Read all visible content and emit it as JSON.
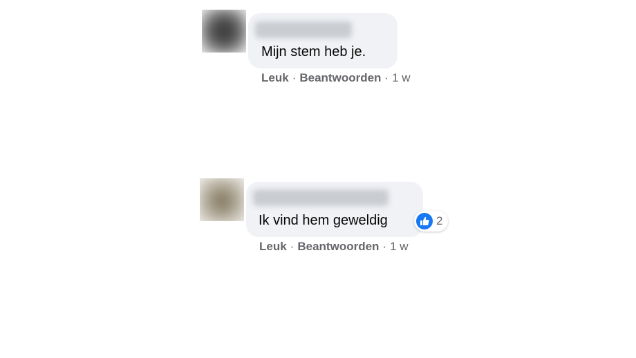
{
  "comments": [
    {
      "author": "",
      "text": "Mijn stem heb je.",
      "actions": {
        "like": "Leuk",
        "reply": "Beantwoorden",
        "separator": "·",
        "timestamp": "1 w"
      }
    },
    {
      "author": "",
      "text": "Ik vind hem geweldig",
      "reaction": {
        "icon": "thumbs-up-icon",
        "color": "#1877f2",
        "count": "2"
      },
      "actions": {
        "like": "Leuk",
        "reply": "Beantwoorden",
        "separator": "·",
        "timestamp": "1 w"
      }
    }
  ]
}
